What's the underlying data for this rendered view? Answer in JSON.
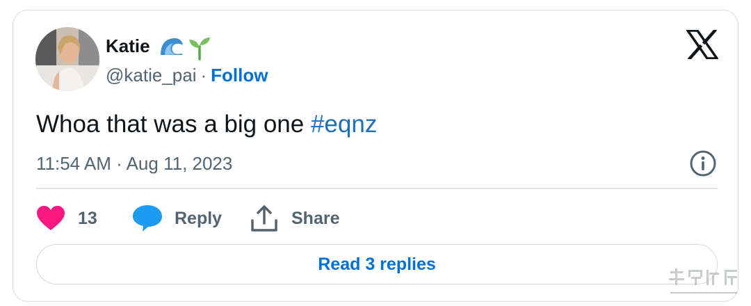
{
  "tweet": {
    "author_name": "Katie",
    "author_emojis": [
      "wave-emoji",
      "seedling-emoji"
    ],
    "handle": "@katie_pai",
    "separator": "·",
    "follow_label": "Follow",
    "text_main": "Whoa that was a big one ",
    "hashtag": "#eqnz",
    "timestamp": "11:54 AM · Aug 11, 2023"
  },
  "actions": {
    "like_count": "13",
    "reply_label": "Reply",
    "share_label": "Share"
  },
  "read_replies_label": "Read 3 replies",
  "colors": {
    "link": "#006fd6",
    "hashtag": "#1d6fb8",
    "like": "#f91880",
    "reply_bubble": "#1d9bf0",
    "muted": "#536471"
  },
  "icons": [
    "x-logo-icon",
    "info-icon",
    "heart-icon",
    "reply-bubble-icon",
    "share-icon"
  ]
}
